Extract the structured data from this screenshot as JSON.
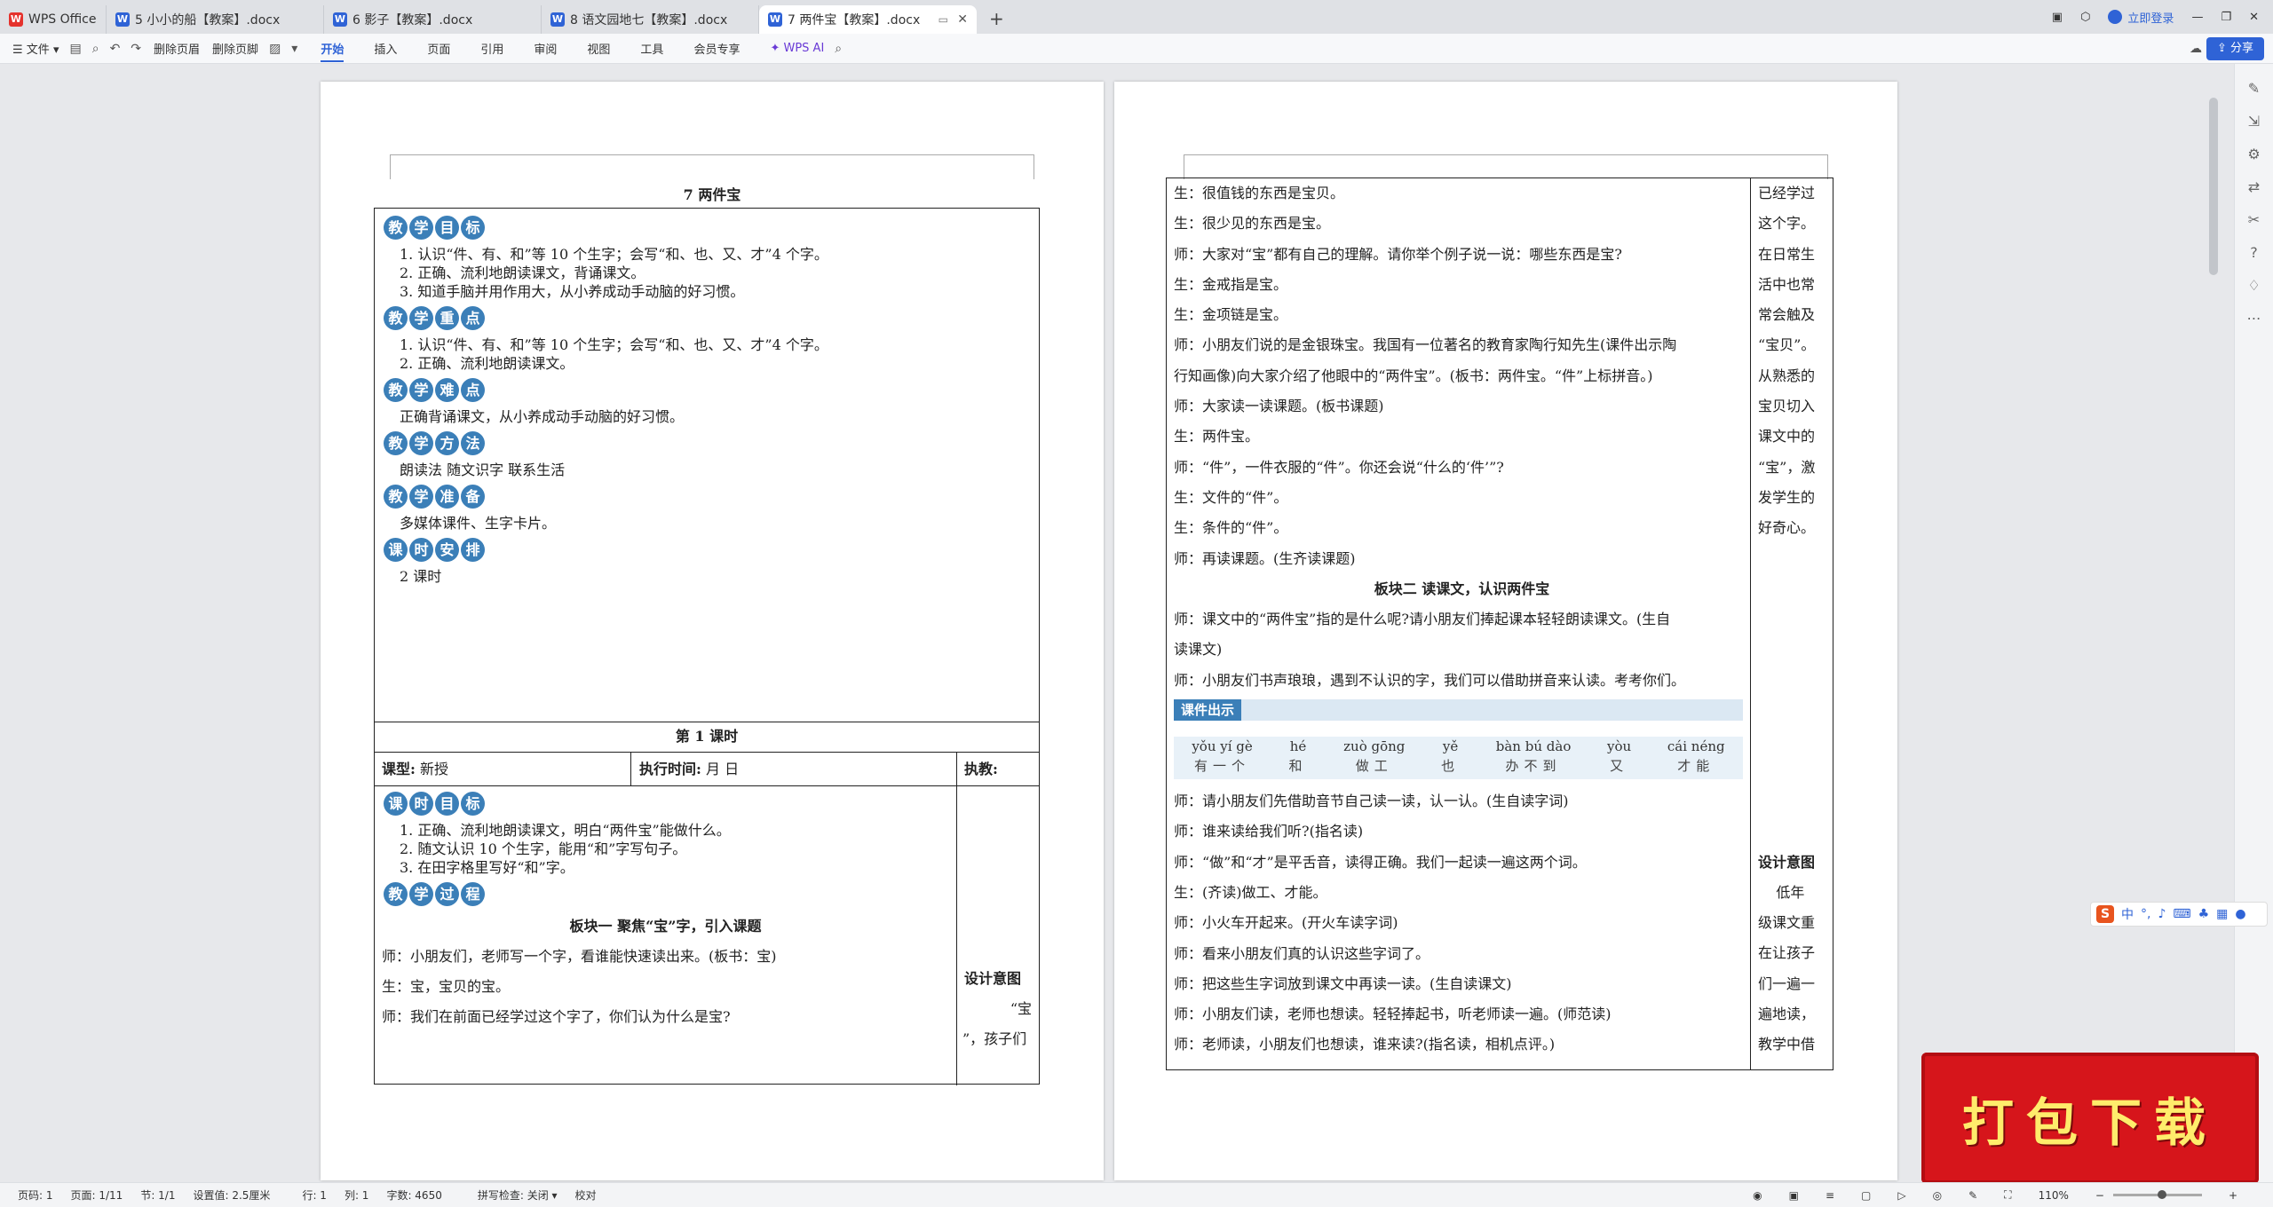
{
  "titlebar": {
    "home_tab": "WPS Office",
    "tabs": [
      {
        "label": "5 小小的船【教案】.docx"
      },
      {
        "label": "6 影子【教案】.docx"
      },
      {
        "label": "8 语文园地七【教案】.docx"
      },
      {
        "label": "7 两件宝【教案】.docx"
      }
    ],
    "login": "立即登录"
  },
  "ribbon": {
    "file": "文件",
    "delete_header": "删除页眉",
    "delete_footer": "删除页脚",
    "tabs": [
      "开始",
      "插入",
      "页面",
      "引用",
      "审阅",
      "视图",
      "工具",
      "会员专享"
    ],
    "active_tab": "开始",
    "ai": "WPS AI",
    "share": "分享"
  },
  "page1": {
    "title": "7  两件宝",
    "sections": [
      {
        "label": [
          "教",
          "学",
          "目",
          "标"
        ],
        "lines": [
          "1. 认识“件、有、和”等 10 个生字；会写“和、也、又、才”4 个字。",
          "2. 正确、流利地朗读课文，背诵课文。",
          "3. 知道手脑并用作用大，从小养成动手动脑的好习惯。"
        ]
      },
      {
        "label": [
          "教",
          "学",
          "重",
          "点"
        ],
        "lines": [
          "1. 认识“件、有、和”等 10 个生字；会写“和、也、又、才”4 个字。",
          "2. 正确、流利地朗读课文。"
        ]
      },
      {
        "label": [
          "教",
          "学",
          "难",
          "点"
        ],
        "lines": [
          "正确背诵课文，从小养成动手动脑的好习惯。"
        ]
      },
      {
        "label": [
          "教",
          "学",
          "方",
          "法"
        ],
        "lines": [
          "朗读法    随文识字    联系生活"
        ]
      },
      {
        "label": [
          "教",
          "学",
          "准",
          "备"
        ],
        "lines": [
          "多媒体课件、生字卡片。"
        ]
      },
      {
        "label": [
          "课",
          "时",
          "安",
          "排"
        ],
        "lines": [
          "2 课时"
        ]
      }
    ],
    "period": "第 1 课时",
    "lesson_type_label": "课型:",
    "lesson_type": "新授",
    "exec_time_label": "执行时间:",
    "exec_time": "月        日",
    "teacher_label": "执教:",
    "period_goal_label": [
      "课",
      "时",
      "目",
      "标"
    ],
    "period_goals": [
      "1. 正确、流利地朗读课文，明白“两件宝”能做什么。",
      "2. 随文认识 10 个生字，能用“和”字写句子。",
      "3. 在田字格里写好“和”字。"
    ],
    "process_label": [
      "教",
      "学",
      "过",
      "程"
    ],
    "block1_title": "板块一    聚焦“宝”字，引入课题",
    "dialog": [
      "师：小朋友们，老师写一个字，看谁能快速读出来。(板书：宝)",
      "生：宝，宝贝的宝。",
      "师：我们在前面已经学过这个字了，你们认为什么是宝?"
    ],
    "design_label": "设计意图",
    "design_text": [
      "“宝",
      "”，孩子们"
    ]
  },
  "page2": {
    "lines_top": [
      "生：很值钱的东西是宝贝。",
      "生：很少见的东西是宝。",
      "师：大家对“宝”都有自己的理解。请你举个例子说一说：哪些东西是宝?",
      "生：金戒指是宝。",
      "生：金项链是宝。",
      "师：小朋友们说的是金银珠宝。我国有一位著名的教育家陶行知先生(课件出示陶",
      "行知画像)向大家介绍了他眼中的“两件宝”。(板书：两件宝。“件”上标拼音。)",
      "师：大家读一读课题。(板书课题)",
      "生：两件宝。",
      "师：“件”，一件衣服的“件”。你还会说“什么的‘件’”?",
      "生：文件的“件”。",
      "生：条件的“件”。",
      "师：再读课题。(生齐读课题)"
    ],
    "block2_title": "板块二    读课文，认识两件宝",
    "lines_mid": [
      "师：课文中的“两件宝”指的是什么呢?请小朋友们捧起课本轻轻朗读课文。(生自",
      "读课文)",
      "师：小朋友们书声琅琅，遇到不认识的字，我们可以借助拼音来认读。考考你们。"
    ],
    "courseware_label": "课件出示",
    "pinyin": [
      {
        "py": "yǒu yí gè",
        "hz": "有一个"
      },
      {
        "py": "hé",
        "hz": "和"
      },
      {
        "py": "zuò gōng",
        "hz": "做工"
      },
      {
        "py": "yě",
        "hz": "也"
      },
      {
        "py": "bàn bú dào",
        "hz": "办不到"
      },
      {
        "py": "yòu",
        "hz": "又"
      },
      {
        "py": "cái néng",
        "hz": "才能"
      }
    ],
    "lines_bottom": [
      "师：请小朋友们先借助音节自己读一读，认一认。(生自读字词)",
      "师：谁来读给我们听?(指名读)",
      "师：“做”和“才”是平舌音，读得正确。我们一起读一遍这两个词。",
      "生：(齐读)做工、才能。",
      "师：小火车开起来。(开火车读字词)",
      "师：看来小朋友们真的认识这些字词了。",
      "师：把这些生字词放到课文中再读一读。(生自读课文)",
      "师：小朋友们读，老师也想读。轻轻捧起书，听老师读一遍。(师范读)",
      "师：老师读，小朋友们也想读，谁来读?(指名读，相机点评。)"
    ],
    "side_top": [
      "已经学过",
      "这个字。",
      "在日常生",
      "活中也常",
      "常会触及",
      "“宝贝”。",
      "从熟悉的",
      "宝贝切入",
      "课文中的",
      "“宝”，激",
      "发学生的",
      "好奇心。"
    ],
    "side_design_label": "设计意图",
    "side_bottom": [
      "    低年",
      "级课文重",
      "在让孩子",
      "们一遍一",
      "遍地读，",
      "教学中借"
    ]
  },
  "statusbar": {
    "page_num": "页码: 1",
    "pages": "页面: 1/11",
    "section": "节: 1/1",
    "setting": "设置值: 2.5厘米",
    "line": "行: 1",
    "col": "列: 1",
    "words": "字数: 4650",
    "spell": "拼写检查: 关闭",
    "proof": "校对",
    "zoom": "110%"
  },
  "overlay": {
    "download": "打包下载"
  }
}
